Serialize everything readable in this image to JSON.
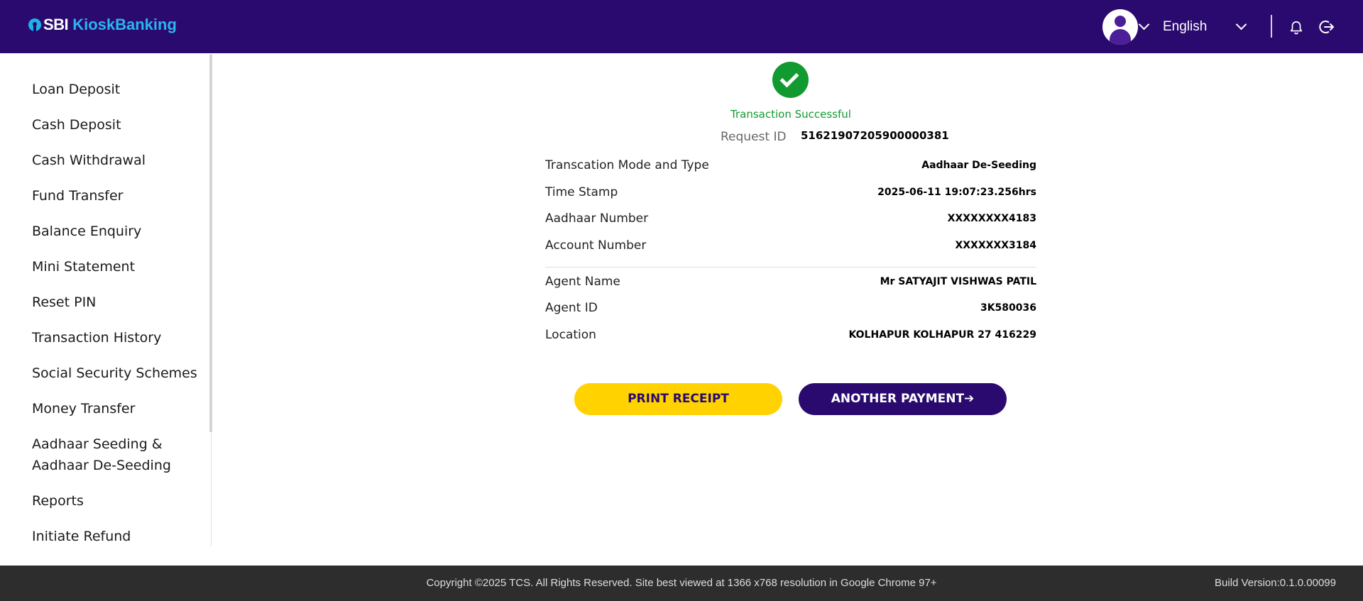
{
  "header": {
    "logo_sbi": "SBI",
    "logo_kiosk": "KioskBanking",
    "language": "English"
  },
  "sidebar": {
    "items": [
      {
        "label": "Loan Deposit"
      },
      {
        "label": "Cash Deposit"
      },
      {
        "label": "Cash Withdrawal"
      },
      {
        "label": "Fund Transfer"
      },
      {
        "label": "Balance Enquiry"
      },
      {
        "label": "Mini Statement"
      },
      {
        "label": "Reset PIN"
      },
      {
        "label": "Transaction History"
      },
      {
        "label": "Social Security Schemes"
      },
      {
        "label": "Money Transfer"
      },
      {
        "label": "Aadhaar Seeding &"
      },
      {
        "label": "Aadhaar De-Seeding"
      },
      {
        "label": "Reports"
      },
      {
        "label": "Initiate Refund"
      }
    ]
  },
  "receipt": {
    "status": "Transaction Successful",
    "request_id_label": "Request ID",
    "request_id_value": "51621907205900000381",
    "rows": [
      {
        "label": "Transcation Mode and Type",
        "value": "Aadhaar De-Seeding"
      },
      {
        "label": "Time Stamp",
        "value": "2025-06-11 19:07:23.256hrs"
      },
      {
        "label": "Aadhaar Number",
        "value": "XXXXXXXX4183"
      },
      {
        "label": "Account Number",
        "value": "XXXXXXX3184"
      },
      {
        "label": "Agent Name",
        "value": "Mr SATYAJIT VISHWAS PATIL"
      },
      {
        "label": "Agent ID",
        "value": "3K580036"
      },
      {
        "label": "Location",
        "value": "KOLHAPUR KOLHAPUR 27 416229"
      }
    ]
  },
  "buttons": {
    "print": "PRINT RECEIPT",
    "another": "ANOTHER PAYMENT➔"
  },
  "footer": {
    "copyright": "Copyright ©2025 TCS. All Rights Reserved. Site best viewed at 1366 x768 resolution in Google Chrome 97+",
    "build": "Build Version:0.1.0.00099"
  },
  "colors": {
    "header_bg": "#2a0a6e",
    "success_green": "#119a2f",
    "print_yellow": "#ffd200",
    "footer_bg": "#2d2d2d"
  },
  "icons": [
    "logo-icon",
    "user-avatar-icon",
    "chevron-down-icon",
    "bell-icon",
    "logout-icon",
    "checkmark-icon"
  ]
}
